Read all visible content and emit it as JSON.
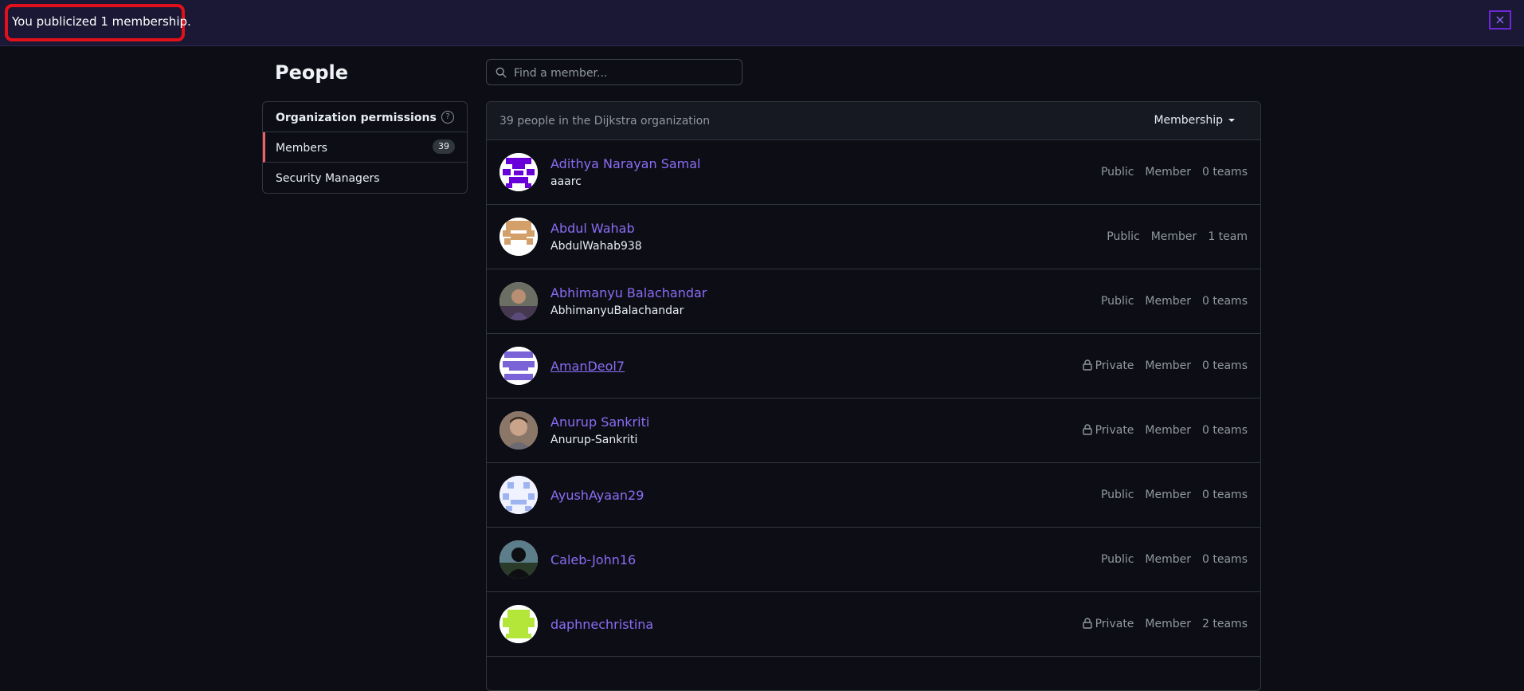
{
  "flash": {
    "message": "You publicized 1 membership.",
    "close_label": "×"
  },
  "page": {
    "title": "People"
  },
  "sidebar": {
    "items": [
      {
        "label": "Organization permissions"
      },
      {
        "label": "Members",
        "count": "39"
      },
      {
        "label": "Security Managers"
      }
    ]
  },
  "search": {
    "placeholder": "Find a member..."
  },
  "members_header": {
    "summary": "39 people in the Dijkstra organization",
    "filter_label": "Membership"
  },
  "members": [
    {
      "name": "Adithya Narayan Samal",
      "login": "aaarc",
      "visibility": "Public",
      "role": "Member",
      "teams": "0 teams"
    },
    {
      "name": "Abdul Wahab",
      "login": "AbdulWahab938",
      "visibility": "Public",
      "role": "Member",
      "teams": "1 team"
    },
    {
      "name": "Abhimanyu Balachandar",
      "login": "AbhimanyuBalachandar",
      "visibility": "Public",
      "role": "Member",
      "teams": "0 teams"
    },
    {
      "name": "AmanDeol7",
      "login": "",
      "visibility": "Private",
      "role": "Member",
      "teams": "0 teams"
    },
    {
      "name": "Anurup Sankriti",
      "login": "Anurup-Sankriti",
      "visibility": "Private",
      "role": "Member",
      "teams": "0 teams"
    },
    {
      "name": "AyushAyaan29",
      "login": "",
      "visibility": "Public",
      "role": "Member",
      "teams": "0 teams"
    },
    {
      "name": "Caleb-John16",
      "login": "",
      "visibility": "Public",
      "role": "Member",
      "teams": "0 teams"
    },
    {
      "name": "daphnechristina",
      "login": "",
      "visibility": "Private",
      "role": "Member",
      "teams": "2 teams"
    }
  ],
  "colors": {
    "accent": "#8b6cf5",
    "highlight": "#e0111b",
    "selected_marker": "#f25f65"
  }
}
